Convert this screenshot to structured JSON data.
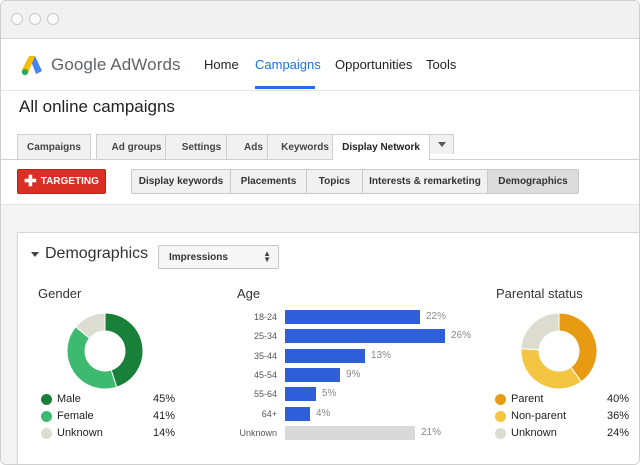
{
  "app": {
    "logo_text": "Google AdWords",
    "brand_colors": {
      "blue": "#4285f4",
      "yellow": "#fbbc05",
      "green": "#34a853"
    }
  },
  "nav": [
    {
      "label": "Home",
      "active": false
    },
    {
      "label": "Campaigns",
      "active": true
    },
    {
      "label": "Opportunities",
      "active": false
    },
    {
      "label": "Tools",
      "active": false
    }
  ],
  "page": {
    "title": "All online campaigns"
  },
  "tabs": [
    {
      "label": "Campaigns"
    },
    {
      "label": "Ad groups"
    },
    {
      "label": "Settings"
    },
    {
      "label": "Ads"
    },
    {
      "label": "Keywords"
    },
    {
      "label": "Display Network",
      "active": true
    }
  ],
  "targeting_button": {
    "label": "TARGETING",
    "icon": "plus-icon",
    "color": "#d93025"
  },
  "subtabs": [
    {
      "label": "Display keywords"
    },
    {
      "label": "Placements"
    },
    {
      "label": "Topics"
    },
    {
      "label": "Interests & remarketing"
    },
    {
      "label": "Demographics",
      "active": true
    }
  ],
  "demographics": {
    "title": "Demographics",
    "metric_select": "Impressions",
    "gender": {
      "title": "Gender",
      "items": [
        {
          "label": "Male",
          "pct": "45%",
          "value": 45,
          "color": "#188038"
        },
        {
          "label": "Female",
          "pct": "41%",
          "value": 41,
          "color": "#3dba6f"
        },
        {
          "label": "Unknown",
          "pct": "14%",
          "value": 14,
          "color": "#dcdcd0"
        }
      ]
    },
    "age": {
      "title": "Age",
      "bar_color": "#2e5fd8",
      "unknown_color": "#d9d9d9",
      "items": [
        {
          "label": "18-24",
          "pct": "22%",
          "value": 22
        },
        {
          "label": "25-34",
          "pct": "26%",
          "value": 26
        },
        {
          "label": "35-44",
          "pct": "13%",
          "value": 13
        },
        {
          "label": "45-54",
          "pct": "9%",
          "value": 9
        },
        {
          "label": "55-64",
          "pct": "5%",
          "value": 5
        },
        {
          "label": "64+",
          "pct": "4%",
          "value": 4
        },
        {
          "label": "Unknown",
          "pct": "21%",
          "value": 21
        }
      ]
    },
    "parental": {
      "title": "Parental status",
      "items": [
        {
          "label": "Parent",
          "pct": "40%",
          "value": 40,
          "color": "#e69b12"
        },
        {
          "label": "Non-parent",
          "pct": "36%",
          "value": 36,
          "color": "#f4c542"
        },
        {
          "label": "Unknown",
          "pct": "24%",
          "value": 24,
          "color": "#dcdcd0"
        }
      ]
    }
  }
}
